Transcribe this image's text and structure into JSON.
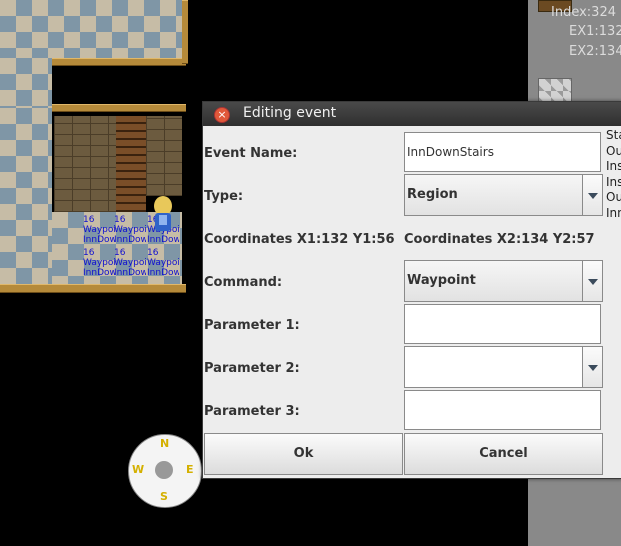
{
  "right_panel": {
    "index_text": "Index:324",
    "ex1_text": "EX1:132",
    "ex2_text": "EX2:134"
  },
  "map_events": [
    {
      "level": "16",
      "name": "Waypoi",
      "sub": "InnDow"
    },
    {
      "level": "16",
      "name": "Waypoi",
      "sub": "InnDow"
    },
    {
      "level": "16",
      "name": "Waypoi",
      "sub": "InnDow"
    },
    {
      "level": "16",
      "name": "Waypoi",
      "sub": "InnDow"
    },
    {
      "level": "16",
      "name": "Waypoi",
      "sub": "InnDow"
    },
    {
      "level": "16",
      "name": "Waypoi",
      "sub": "InnDow"
    }
  ],
  "compass": {
    "n": "N",
    "e": "E",
    "s": "S",
    "w": "W"
  },
  "dialog": {
    "title": "Editing event",
    "event_name_label": "Event Name:",
    "event_name_value": "InnDownStairs",
    "type_label": "Type:",
    "type_value": "Region",
    "coord1": "Coordinates X1:132 Y1:56",
    "coord2": "Coordinates X2:134 Y2:57",
    "command_label": "Command:",
    "command_value": "Waypoint",
    "param1_label": "Parameter 1:",
    "param1_value": "",
    "param2_label": "Parameter 2:",
    "param2_value": "",
    "param3_label": "Parameter 3:",
    "param3_value": "",
    "ok_label": "Ok",
    "cancel_label": "Cancel",
    "side_list": [
      "Sta",
      "Ou",
      "Ins",
      "Ins",
      "Ou",
      "Inn"
    ]
  }
}
